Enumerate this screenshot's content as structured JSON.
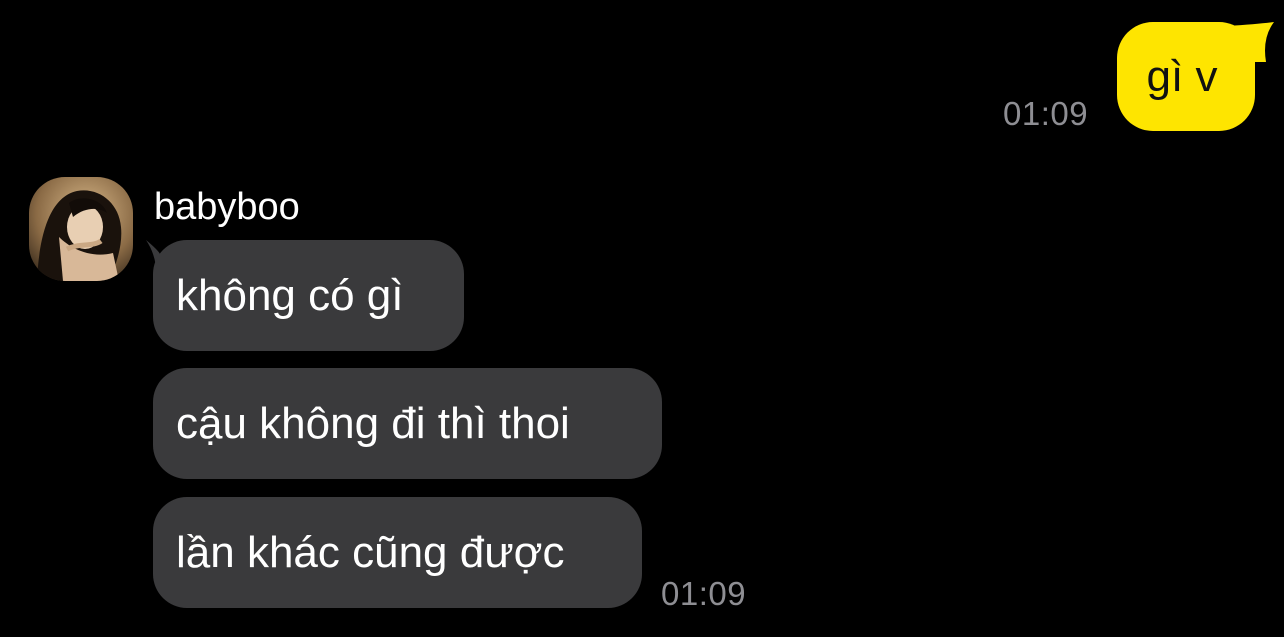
{
  "colors": {
    "background": "#000000",
    "sent_bubble": "#fee500",
    "received_bubble": "#3a3a3c",
    "timestamp": "#8e8e93"
  },
  "sent_message": {
    "text": "gì v",
    "time": "01:09"
  },
  "received_group": {
    "sender_name": "babyboo",
    "avatar_icon": "profile-photo",
    "messages": [
      {
        "text": "không có gì"
      },
      {
        "text": "cậu không đi thì thoi"
      },
      {
        "text": "lần khác cũng được"
      }
    ],
    "time": "01:09"
  }
}
